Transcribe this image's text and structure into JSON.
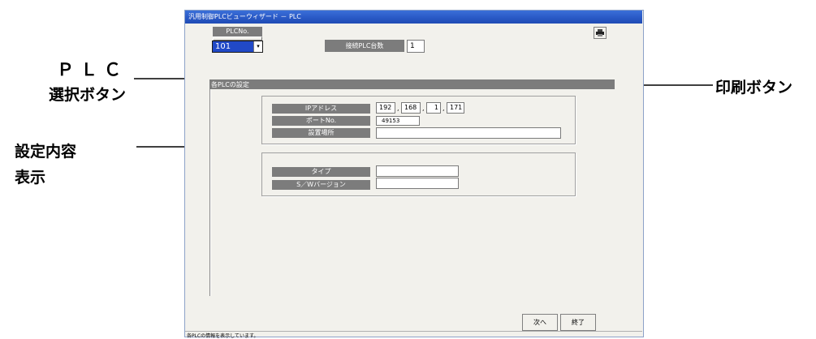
{
  "window": {
    "title": "汎用制御PLCビューウィザード － PLC"
  },
  "plc_select": {
    "caption": "PLCNo.",
    "value": "101"
  },
  "connected": {
    "caption": "接続PLC台数",
    "value": "1"
  },
  "settings_section": {
    "title": "各PLCの設定"
  },
  "network_group": {
    "ip_label": "IPアドレス",
    "ip": [
      "192",
      "168",
      "1",
      "171"
    ],
    "port_label": "ポートNo.",
    "port_value": "49153",
    "location_label": "設置場所",
    "location_value": ""
  },
  "device_group": {
    "type_label": "タイプ",
    "type_value": "",
    "version_label": "S／Wバージョン",
    "version_value": ""
  },
  "footer": {
    "next_label": "次へ",
    "exit_label": "終了",
    "status": "各PLCの情報を表示しています。"
  },
  "annotations": {
    "plc_select_line1": "ＰＬＣ",
    "plc_select_line2": "選択ボタン",
    "settings_line1": "設定内容",
    "settings_line2": "表示",
    "print_button": "印刷ボタン"
  },
  "icons": {
    "print": "printer-icon",
    "dropdown": "dropdown-arrow-icon"
  }
}
